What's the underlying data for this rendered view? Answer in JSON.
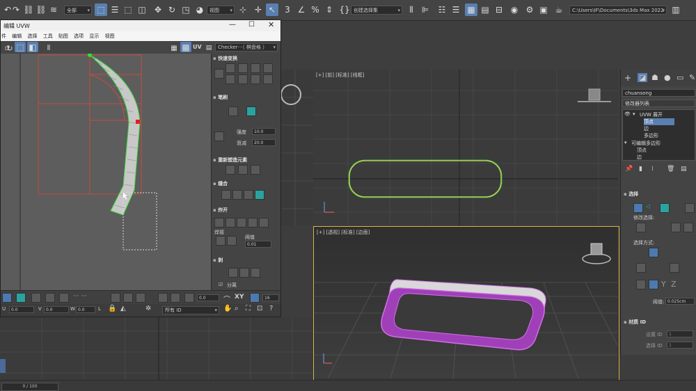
{
  "toolbar": {
    "selection_filter": "全部",
    "reference_coord": "视图",
    "named_selection": "创建选择集",
    "project_path": "C:\\Users\\IF\\Documents\\3ds Max 2022"
  },
  "uvw_window": {
    "title": "编辑 UVW",
    "menu": [
      "件",
      "编辑",
      "选择",
      "工具",
      "贴图",
      "选项",
      "显示",
      "视图"
    ],
    "texture_dropdown": "Checker···（ 棋盘格 ）",
    "uv_label": "UV",
    "panel": {
      "quick_transform": "快速变换",
      "brush": "笔刷",
      "strength_label": "强度",
      "strength_value": "10.0",
      "falloff_label": "衰减",
      "falloff_value": "20.0",
      "reshape": "重新塑造元素",
      "stitch": "缝合",
      "explode": "炸开",
      "weld": "焊接",
      "threshold_label": "阈值",
      "threshold_value": "0.01",
      "peel": "剥",
      "detach": "分离"
    },
    "bottom": {
      "angle_value": "0.0",
      "xy_label": "XY",
      "grid_value": "16",
      "u_label": "U",
      "u_value": "0.0",
      "v_label": "V",
      "v_value": "0.0",
      "w_label": "W",
      "w_value": "0.0",
      "l_label": "L",
      "id_filter": "所有 ID"
    }
  },
  "viewports": {
    "front_label": "[+] [前] [标准] [线框]",
    "persp_label": "[+] [透视] [标准] [边面]"
  },
  "command_panel": {
    "object_name": "chuansong",
    "modifier_list": "修改器列表",
    "stack": [
      {
        "label": "UVW 展开",
        "level": 0
      },
      {
        "label": "顶点",
        "level": 1,
        "selected": true
      },
      {
        "label": "边",
        "level": 1
      },
      {
        "label": "多边形",
        "level": 1
      },
      {
        "label": "可编辑多边形",
        "level": 0
      },
      {
        "label": "顶点",
        "level": 1
      },
      {
        "label": "边",
        "level": 1
      }
    ],
    "selection_title": "选择",
    "modify_selection": "修改选择:",
    "selection_method": "选择方式:",
    "threshold_label": "阈值:",
    "threshold_value": "0.025cm",
    "material_id_title": "材质 ID",
    "set_id_label": "设置 ID",
    "set_id_value": "1",
    "select_id_label": "选择 ID",
    "select_id_value": "1"
  },
  "timeline": {
    "frame": "0 / 100"
  }
}
